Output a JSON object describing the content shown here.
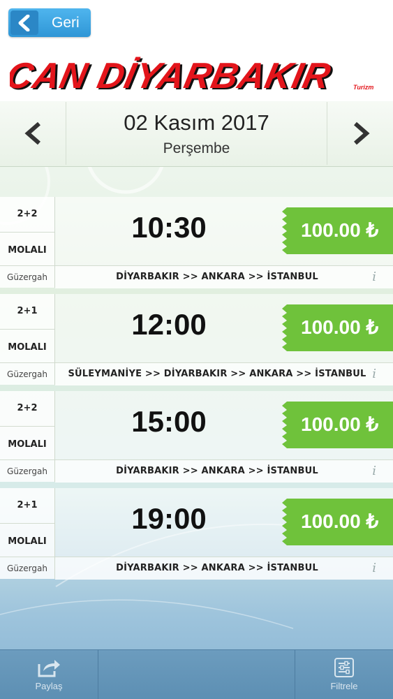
{
  "header": {
    "back_label": "Geri",
    "logo_text": "CAN DİYARBAKIR",
    "logo_sub": "Turizm"
  },
  "datebar": {
    "date": "02 Kasım 2017",
    "day": "Perşembe"
  },
  "labels": {
    "molali": "MOLALI",
    "guzergah": "Güzergah"
  },
  "trips": [
    {
      "seat": "2+2",
      "time": "10:30",
      "price": "100.00 ₺",
      "route": "DİYARBAKIR >> ANKARA >> İSTANBUL"
    },
    {
      "seat": "2+1",
      "time": "12:00",
      "price": "100.00 ₺",
      "route": "SÜLEYMANİYE >> DİYARBAKIR >> ANKARA >> İSTANBUL"
    },
    {
      "seat": "2+2",
      "time": "15:00",
      "price": "100.00 ₺",
      "route": "DİYARBAKIR >> ANKARA >> İSTANBUL"
    },
    {
      "seat": "2+1",
      "time": "19:00",
      "price": "100.00 ₺",
      "route": "DİYARBAKIR >> ANKARA >> İSTANBUL"
    }
  ],
  "bottombar": {
    "share_label": "Paylaş",
    "filter_label": "Filtrele"
  },
  "colors": {
    "price_green": "#6fc23b",
    "back_blue": "#2f96d6",
    "logo_red": "#e3151b",
    "bottom_blue": "#6c9cbe"
  },
  "icons": {
    "back": "chevron-left-icon",
    "prev": "chevron-left-icon",
    "next": "chevron-right-icon",
    "info": "info-icon",
    "share": "share-icon",
    "filter": "filter-icon"
  }
}
